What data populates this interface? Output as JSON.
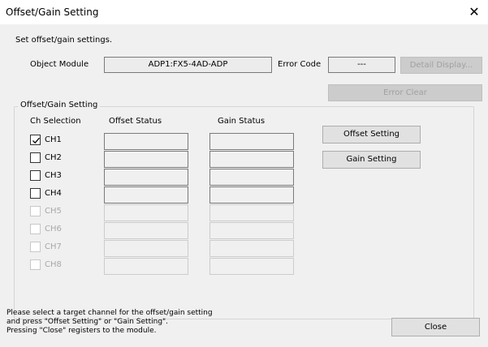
{
  "window": {
    "title": "Offset/Gain Setting",
    "close_glyph": "✕"
  },
  "intro": "Set offset/gain settings.",
  "object_module": {
    "label": "Object Module",
    "value": "ADP1:FX5-4AD-ADP"
  },
  "error_code": {
    "label": "Error Code",
    "value": "---"
  },
  "buttons": {
    "detail_display": "Detail Display...",
    "error_clear": "Error Clear",
    "offset_setting": "Offset Setting",
    "gain_setting": "Gain Setting",
    "close": "Close"
  },
  "group": {
    "title": "Offset/Gain Setting",
    "col_ch": "Ch Selection",
    "col_offset": "Offset Status",
    "col_gain": "Gain Status"
  },
  "channels": [
    {
      "label": "CH1",
      "checked": true,
      "enabled": true,
      "offset_status": "",
      "gain_status": ""
    },
    {
      "label": "CH2",
      "checked": false,
      "enabled": true,
      "offset_status": "",
      "gain_status": ""
    },
    {
      "label": "CH3",
      "checked": false,
      "enabled": true,
      "offset_status": "",
      "gain_status": ""
    },
    {
      "label": "CH4",
      "checked": false,
      "enabled": true,
      "offset_status": "",
      "gain_status": ""
    },
    {
      "label": "CH5",
      "checked": false,
      "enabled": false,
      "offset_status": "",
      "gain_status": ""
    },
    {
      "label": "CH6",
      "checked": false,
      "enabled": false,
      "offset_status": "",
      "gain_status": ""
    },
    {
      "label": "CH7",
      "checked": false,
      "enabled": false,
      "offset_status": "",
      "gain_status": ""
    },
    {
      "label": "CH8",
      "checked": false,
      "enabled": false,
      "offset_status": "",
      "gain_status": ""
    }
  ],
  "footer": {
    "line1": "Please select a target channel for the offset/gain setting",
    "line2": "and press \"Offset Setting\" or \"Gain Setting\".",
    "line3": "Pressing \"Close\" registers to the module."
  }
}
